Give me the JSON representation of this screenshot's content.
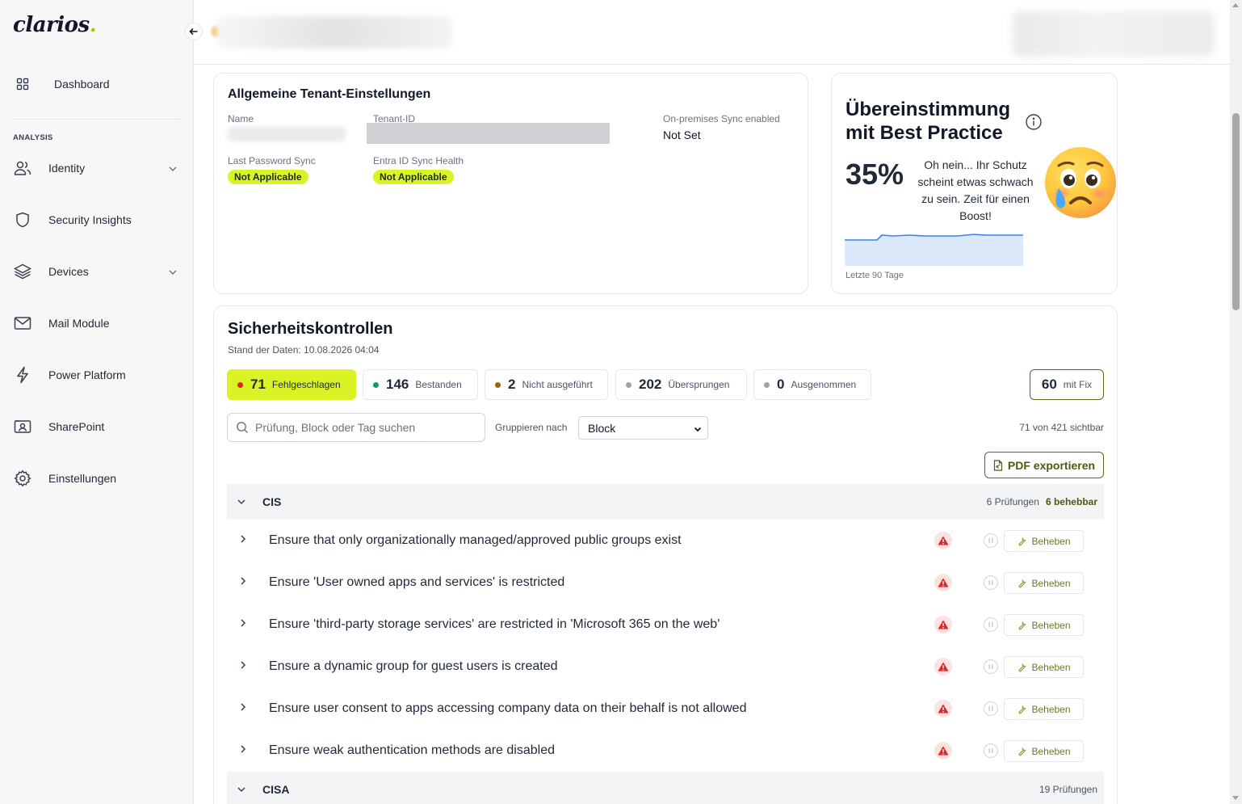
{
  "app": {
    "logo_text": "clarios",
    "logo_dot": "."
  },
  "sidebar": {
    "items": [
      {
        "label": "Dashboard",
        "icon": "grid-icon"
      },
      {
        "label": "Identity",
        "icon": "users-icon"
      },
      {
        "label": "Security Insights",
        "icon": "shield-icon"
      },
      {
        "label": "Devices",
        "icon": "layers-icon"
      },
      {
        "label": "Mail Module",
        "icon": "mail-icon"
      },
      {
        "label": "Power Platform",
        "icon": "bolt-icon"
      },
      {
        "label": "SharePoint",
        "icon": "sharepoint-icon"
      },
      {
        "label": "Einstellungen",
        "icon": "gear-icon"
      }
    ],
    "section_label": "ANALYSIS"
  },
  "tenant": {
    "title": "Allgemeine Tenant-Einstellungen",
    "name_label": "Name",
    "tenant_id_label": "Tenant-ID",
    "onprem_label": "On-premises Sync enabled",
    "onprem_value": "Not Set",
    "last_pw_label": "Last Password Sync",
    "last_pw_value": "Not Applicable",
    "entra_label": "Entra ID Sync Health",
    "entra_value": "Not Applicable"
  },
  "best_practice": {
    "title": "Übereinstimmung mit Best Practice",
    "percent": "35%",
    "percent_value": 35,
    "message": "Oh nein... Ihr Schutz scheint etwas schwach zu sein. Zeit für einen Boost!",
    "footer": "Letzte 90 Tage"
  },
  "security": {
    "title": "Sicherheitskontrollen",
    "subtitle": "Stand der Daten: 10.08.2026 04:04",
    "chips": [
      {
        "count": "71",
        "label": "Fehlgeschlagen",
        "color": "#dc2626"
      },
      {
        "count": "146",
        "label": "Bestanden",
        "color": "#0f9a6e"
      },
      {
        "count": "2",
        "label": "Nicht ausgeführt",
        "color": "#a16207"
      },
      {
        "count": "202",
        "label": "Übersprungen",
        "color": "#9ca3af"
      },
      {
        "count": "0",
        "label": "Ausgenommen",
        "color": "#9ca3af"
      }
    ],
    "fix_count": "60",
    "fix_label": "mit Fix",
    "search_placeholder": "Prüfung, Block oder Tag suchen",
    "group_by_label": "Gruppieren nach",
    "group_by_value": "Block",
    "visible_count": "71 von 421 sichtbar",
    "pdf_label": "PDF exportieren",
    "fix_button_label": "Beheben",
    "groups": [
      {
        "name": "CIS",
        "count_text": "6 Prüfungen",
        "fixable_text": "6 behebbar",
        "items": [
          "Ensure that only organizationally managed/approved public groups exist",
          "Ensure 'User owned apps and services' is restricted",
          "Ensure 'third-party storage services' are restricted in 'Microsoft 365 on the web'",
          "Ensure a dynamic group for guest users is created",
          "Ensure user consent to apps accessing company data on their behalf is not allowed",
          "Ensure weak authentication methods are disabled"
        ]
      },
      {
        "name": "CISA",
        "count_text": "19 Prüfungen",
        "fixable_text": ""
      }
    ]
  }
}
